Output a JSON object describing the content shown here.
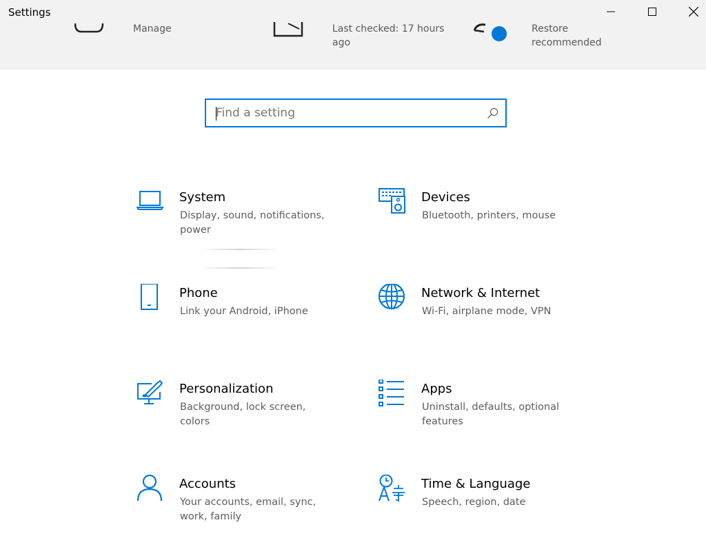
{
  "window": {
    "title": "Settings",
    "controls": {
      "minimize": "minimize-icon",
      "maximize": "maximize-icon",
      "close": "close-icon"
    }
  },
  "banner": {
    "items": [
      {
        "text": "Manage"
      },
      {
        "text": "Last checked: 17 hours ago"
      },
      {
        "text": "Restore recommended"
      }
    ]
  },
  "search": {
    "placeholder": "Find a setting",
    "value": ""
  },
  "categories": [
    {
      "title": "System",
      "desc": "Display, sound, notifications, power",
      "icon": "laptop-icon"
    },
    {
      "title": "Devices",
      "desc": "Bluetooth, printers, mouse",
      "icon": "keyboard-speaker-icon"
    },
    {
      "title": "Phone",
      "desc": "Link your Android, iPhone",
      "icon": "phone-icon"
    },
    {
      "title": "Network & Internet",
      "desc": "Wi-Fi, airplane mode, VPN",
      "icon": "globe-icon"
    },
    {
      "title": "Personalization",
      "desc": "Background, lock screen, colors",
      "icon": "paint-monitor-icon"
    },
    {
      "title": "Apps",
      "desc": "Uninstall, defaults, optional features",
      "icon": "apps-list-icon"
    },
    {
      "title": "Accounts",
      "desc": "Your accounts, email, sync, work, family",
      "icon": "person-icon"
    },
    {
      "title": "Time & Language",
      "desc": "Speech, region, date",
      "icon": "time-language-icon"
    }
  ],
  "colors": {
    "accent": "#0078d7",
    "banner_bg": "#f2f2f2",
    "dot": "#0078d7"
  }
}
